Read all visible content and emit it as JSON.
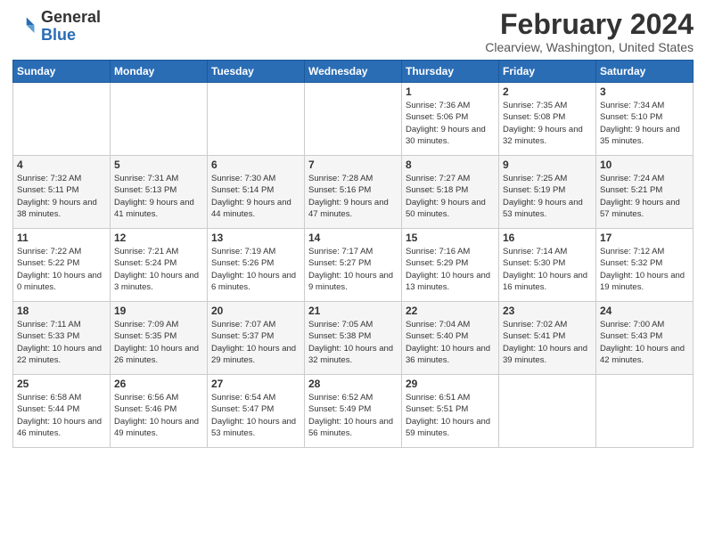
{
  "header": {
    "logo_general": "General",
    "logo_blue": "Blue",
    "month_title": "February 2024",
    "location": "Clearview, Washington, United States"
  },
  "weekdays": [
    "Sunday",
    "Monday",
    "Tuesday",
    "Wednesday",
    "Thursday",
    "Friday",
    "Saturday"
  ],
  "weeks": [
    [
      {
        "day": "",
        "info": ""
      },
      {
        "day": "",
        "info": ""
      },
      {
        "day": "",
        "info": ""
      },
      {
        "day": "",
        "info": ""
      },
      {
        "day": "1",
        "info": "Sunrise: 7:36 AM\nSunset: 5:06 PM\nDaylight: 9 hours and 30 minutes."
      },
      {
        "day": "2",
        "info": "Sunrise: 7:35 AM\nSunset: 5:08 PM\nDaylight: 9 hours and 32 minutes."
      },
      {
        "day": "3",
        "info": "Sunrise: 7:34 AM\nSunset: 5:10 PM\nDaylight: 9 hours and 35 minutes."
      }
    ],
    [
      {
        "day": "4",
        "info": "Sunrise: 7:32 AM\nSunset: 5:11 PM\nDaylight: 9 hours and 38 minutes."
      },
      {
        "day": "5",
        "info": "Sunrise: 7:31 AM\nSunset: 5:13 PM\nDaylight: 9 hours and 41 minutes."
      },
      {
        "day": "6",
        "info": "Sunrise: 7:30 AM\nSunset: 5:14 PM\nDaylight: 9 hours and 44 minutes."
      },
      {
        "day": "7",
        "info": "Sunrise: 7:28 AM\nSunset: 5:16 PM\nDaylight: 9 hours and 47 minutes."
      },
      {
        "day": "8",
        "info": "Sunrise: 7:27 AM\nSunset: 5:18 PM\nDaylight: 9 hours and 50 minutes."
      },
      {
        "day": "9",
        "info": "Sunrise: 7:25 AM\nSunset: 5:19 PM\nDaylight: 9 hours and 53 minutes."
      },
      {
        "day": "10",
        "info": "Sunrise: 7:24 AM\nSunset: 5:21 PM\nDaylight: 9 hours and 57 minutes."
      }
    ],
    [
      {
        "day": "11",
        "info": "Sunrise: 7:22 AM\nSunset: 5:22 PM\nDaylight: 10 hours and 0 minutes."
      },
      {
        "day": "12",
        "info": "Sunrise: 7:21 AM\nSunset: 5:24 PM\nDaylight: 10 hours and 3 minutes."
      },
      {
        "day": "13",
        "info": "Sunrise: 7:19 AM\nSunset: 5:26 PM\nDaylight: 10 hours and 6 minutes."
      },
      {
        "day": "14",
        "info": "Sunrise: 7:17 AM\nSunset: 5:27 PM\nDaylight: 10 hours and 9 minutes."
      },
      {
        "day": "15",
        "info": "Sunrise: 7:16 AM\nSunset: 5:29 PM\nDaylight: 10 hours and 13 minutes."
      },
      {
        "day": "16",
        "info": "Sunrise: 7:14 AM\nSunset: 5:30 PM\nDaylight: 10 hours and 16 minutes."
      },
      {
        "day": "17",
        "info": "Sunrise: 7:12 AM\nSunset: 5:32 PM\nDaylight: 10 hours and 19 minutes."
      }
    ],
    [
      {
        "day": "18",
        "info": "Sunrise: 7:11 AM\nSunset: 5:33 PM\nDaylight: 10 hours and 22 minutes."
      },
      {
        "day": "19",
        "info": "Sunrise: 7:09 AM\nSunset: 5:35 PM\nDaylight: 10 hours and 26 minutes."
      },
      {
        "day": "20",
        "info": "Sunrise: 7:07 AM\nSunset: 5:37 PM\nDaylight: 10 hours and 29 minutes."
      },
      {
        "day": "21",
        "info": "Sunrise: 7:05 AM\nSunset: 5:38 PM\nDaylight: 10 hours and 32 minutes."
      },
      {
        "day": "22",
        "info": "Sunrise: 7:04 AM\nSunset: 5:40 PM\nDaylight: 10 hours and 36 minutes."
      },
      {
        "day": "23",
        "info": "Sunrise: 7:02 AM\nSunset: 5:41 PM\nDaylight: 10 hours and 39 minutes."
      },
      {
        "day": "24",
        "info": "Sunrise: 7:00 AM\nSunset: 5:43 PM\nDaylight: 10 hours and 42 minutes."
      }
    ],
    [
      {
        "day": "25",
        "info": "Sunrise: 6:58 AM\nSunset: 5:44 PM\nDaylight: 10 hours and 46 minutes."
      },
      {
        "day": "26",
        "info": "Sunrise: 6:56 AM\nSunset: 5:46 PM\nDaylight: 10 hours and 49 minutes."
      },
      {
        "day": "27",
        "info": "Sunrise: 6:54 AM\nSunset: 5:47 PM\nDaylight: 10 hours and 53 minutes."
      },
      {
        "day": "28",
        "info": "Sunrise: 6:52 AM\nSunset: 5:49 PM\nDaylight: 10 hours and 56 minutes."
      },
      {
        "day": "29",
        "info": "Sunrise: 6:51 AM\nSunset: 5:51 PM\nDaylight: 10 hours and 59 minutes."
      },
      {
        "day": "",
        "info": ""
      },
      {
        "day": "",
        "info": ""
      }
    ]
  ]
}
